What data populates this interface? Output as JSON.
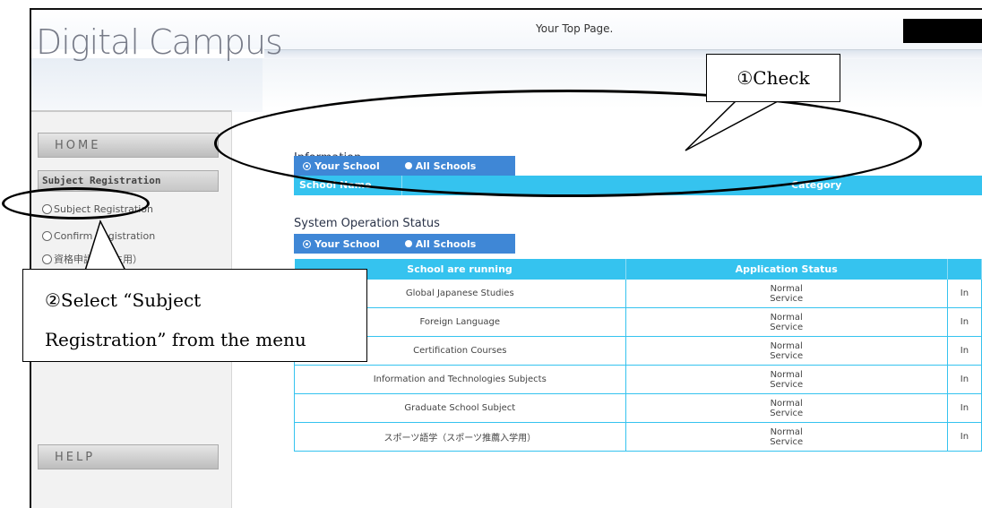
{
  "header": {
    "logo": "Digital Campus",
    "top_page": "Your Top Page."
  },
  "sidebar": {
    "home": "HOME",
    "subject_registration_header": "Subject Registration",
    "items": [
      {
        "label": "Subject Registration"
      },
      {
        "label": "Confirm Registration"
      },
      {
        "label": "資格申請（学生用）"
      },
      {
        "label": ""
      }
    ],
    "help": "HELP"
  },
  "information": {
    "title": "Information",
    "filters": [
      "Your School",
      "All Schools"
    ],
    "columns": [
      "School Name",
      "Category"
    ]
  },
  "status": {
    "title": "System Operation Status",
    "filters": [
      "Your School",
      "All Schools"
    ],
    "columns": [
      "School are running",
      "Application Status",
      ""
    ],
    "rows": [
      {
        "school": "Global Japanese Studies",
        "status": "Normal Service",
        "extra": "In"
      },
      {
        "school": "Foreign Language",
        "status": "Normal Service",
        "extra": "In"
      },
      {
        "school": "Certification Courses",
        "status": "Normal Service",
        "extra": "In"
      },
      {
        "school": "Information and Technologies Subjects",
        "status": "Normal Service",
        "extra": "In"
      },
      {
        "school": "Graduate School Subject",
        "status": "Normal Service",
        "extra": "In"
      },
      {
        "school": "スポーツ語学（スポーツ推薦入学用）",
        "status": "Normal Service",
        "extra": "In"
      }
    ]
  },
  "annotations": {
    "check": "①Check",
    "select_line1": "②Select “Subject",
    "select_line2": "Registration” from the menu"
  },
  "colors": {
    "filter_bar": "#3f87d6",
    "table_header": "#35c3ef"
  }
}
